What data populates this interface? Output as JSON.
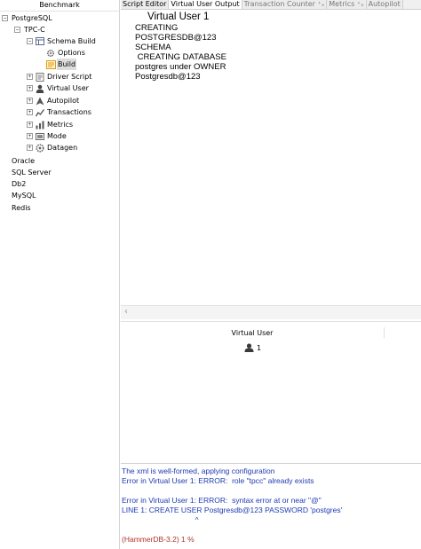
{
  "benchmark_panel": {
    "title": "Benchmark",
    "tree": [
      {
        "label": "PostgreSQL",
        "expander": "−",
        "icon": "none"
      },
      {
        "label": "TPC-C",
        "expander": "−",
        "icon": "none"
      },
      {
        "label": "Schema Build",
        "expander": "−",
        "icon": "schema-build-icon"
      },
      {
        "label": "Options",
        "expander": "",
        "icon": "options-gear-icon"
      },
      {
        "label": "Build",
        "expander": "",
        "icon": "build-icon",
        "selected": true
      },
      {
        "label": "Driver Script",
        "expander": "+",
        "icon": "driver-script-icon"
      },
      {
        "label": "Virtual User",
        "expander": "+",
        "icon": "virtual-user-icon"
      },
      {
        "label": "Autopilot",
        "expander": "+",
        "icon": "autopilot-icon"
      },
      {
        "label": "Transactions",
        "expander": "+",
        "icon": "transactions-icon"
      },
      {
        "label": "Metrics",
        "expander": "+",
        "icon": "metrics-icon"
      },
      {
        "label": "Mode",
        "expander": "+",
        "icon": "mode-icon"
      },
      {
        "label": "Datagen",
        "expander": "+",
        "icon": "datagen-icon"
      },
      {
        "label": "Oracle",
        "expander": "",
        "icon": "none"
      },
      {
        "label": "SQL Server",
        "expander": "",
        "icon": "none"
      },
      {
        "label": "Db2",
        "expander": "",
        "icon": "none"
      },
      {
        "label": "MySQL",
        "expander": "",
        "icon": "none"
      },
      {
        "label": "Redis",
        "expander": "",
        "icon": "none"
      }
    ]
  },
  "tabs": [
    {
      "label": "Script Editor",
      "active": false
    },
    {
      "label": "Virtual User Output",
      "active": true
    },
    {
      "label": "Transaction Counter ⁺ₓ",
      "active": false
    },
    {
      "label": "Metrics ⁺ₓ",
      "active": false
    },
    {
      "label": "Autopilot",
      "active": false
    }
  ],
  "virtual_user_output": {
    "title": "Virtual User 1",
    "lines": [
      "CREATING",
      "POSTGRESDB@123",
      "SCHEMA",
      " CREATING DATABASE",
      "postgres under OWNER",
      "Postgresdb@123"
    ]
  },
  "virtual_user_table": {
    "header": "Virtual User",
    "users": [
      {
        "id": "1",
        "icon": "user-icon"
      }
    ]
  },
  "console": {
    "lines": [
      {
        "text": "The xml is well-formed, applying configuration",
        "style": "blue"
      },
      {
        "text": "Error in Virtual User 1: ERROR:  role \"tpcc\" already exists",
        "style": "blue"
      },
      {
        "text": "",
        "style": "blue"
      },
      {
        "text": "Error in Virtual User 1: ERROR:  syntax error at or near \"@\"",
        "style": "blue"
      },
      {
        "text": "LINE 1: CREATE USER Postgresdb@123 PASSWORD 'postgres'",
        "style": "blue"
      },
      {
        "text": "                                   ^",
        "style": "blue"
      },
      {
        "text": "",
        "style": "blue"
      },
      {
        "text": "(HammerDB-3.2) 1 %",
        "style": "red"
      }
    ]
  },
  "colors": {
    "console_text": "#1f3bb3",
    "prompt_text": "#b0352a",
    "selected_row": "#dcdcdc"
  }
}
